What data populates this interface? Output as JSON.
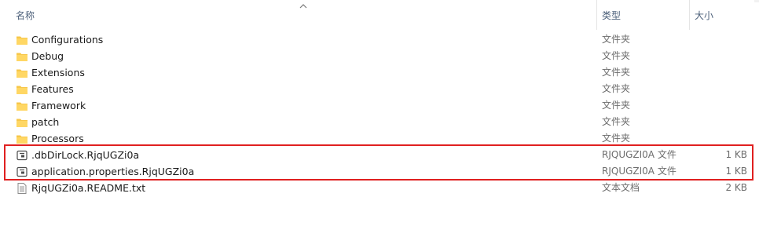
{
  "columns": {
    "name": "名称",
    "type": "类型",
    "size": "大小"
  },
  "files": [
    {
      "name": "Configurations",
      "type": "文件夹",
      "size": "",
      "icon": "folder-icon"
    },
    {
      "name": "Debug",
      "type": "文件夹",
      "size": "",
      "icon": "folder-icon"
    },
    {
      "name": "Extensions",
      "type": "文件夹",
      "size": "",
      "icon": "folder-icon"
    },
    {
      "name": "Features",
      "type": "文件夹",
      "size": "",
      "icon": "folder-icon"
    },
    {
      "name": "Framework",
      "type": "文件夹",
      "size": "",
      "icon": "folder-icon"
    },
    {
      "name": "patch",
      "type": "文件夹",
      "size": "",
      "icon": "folder-icon"
    },
    {
      "name": "Processors",
      "type": "文件夹",
      "size": "",
      "icon": "folder-icon"
    },
    {
      "name": ".dbDirLock.RjqUGZi0a",
      "type": "RJQUGZI0A 文件",
      "size": "1 KB",
      "icon": "generic-file-icon"
    },
    {
      "name": "application.properties.RjqUGZi0a",
      "type": "RJQUGZI0A 文件",
      "size": "1 KB",
      "icon": "generic-file-icon"
    },
    {
      "name": "RjqUGZi0a.README.txt",
      "type": "文本文档",
      "size": "2 KB",
      "icon": "text-file-icon"
    }
  ],
  "colors": {
    "folder": "#f7c74a",
    "highlight": "#e02020",
    "header_text": "#4c607a"
  }
}
